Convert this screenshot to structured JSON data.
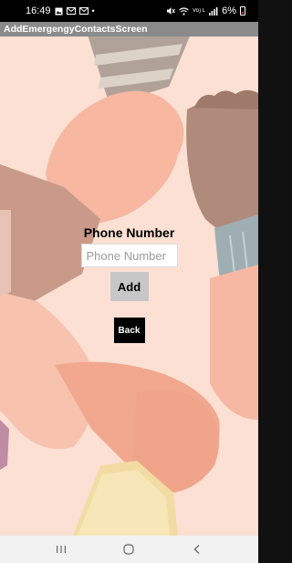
{
  "status_bar": {
    "time": "16:49",
    "notification_icons": [
      "gallery-icon",
      "mail-icon",
      "mail-icon",
      "dot-icon"
    ],
    "network_text": "Vo) LTE1",
    "battery_text": "6%",
    "battery_color": "#e53935"
  },
  "header": {
    "title": "AddEmergengyContactsScreen",
    "background": "#8a8a8a"
  },
  "form": {
    "title": "Phone Number",
    "phone_placeholder": "Phone Number",
    "phone_value": "",
    "add_label": "Add",
    "back_label": "Back"
  },
  "nav_bar": {
    "buttons": [
      "recents-icon",
      "home-icon",
      "back-nav-icon"
    ]
  }
}
